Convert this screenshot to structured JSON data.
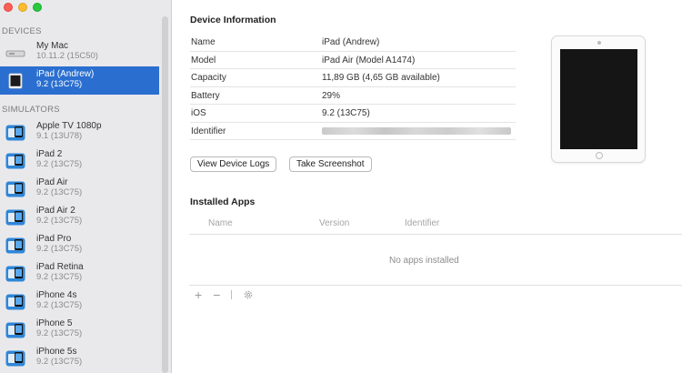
{
  "sidebar": {
    "devices_header": "DEVICES",
    "simulators_header": "SIMULATORS",
    "devices": [
      {
        "name": "My Mac",
        "sub": "10.11.2 (15C50)",
        "icon": "mac-mini-icon"
      },
      {
        "name": "iPad (Andrew)",
        "sub": "9.2 (13C75)",
        "icon": "ipad-icon",
        "selected": true
      }
    ],
    "simulators": [
      {
        "name": "Apple TV 1080p",
        "sub": "9.1 (13U78)"
      },
      {
        "name": "iPad 2",
        "sub": "9.2 (13C75)"
      },
      {
        "name": "iPad Air",
        "sub": "9.2 (13C75)"
      },
      {
        "name": "iPad Air 2",
        "sub": "9.2 (13C75)"
      },
      {
        "name": "iPad Pro",
        "sub": "9.2 (13C75)"
      },
      {
        "name": "iPad Retina",
        "sub": "9.2 (13C75)"
      },
      {
        "name": "iPhone 4s",
        "sub": "9.2 (13C75)"
      },
      {
        "name": "iPhone 5",
        "sub": "9.2 (13C75)"
      },
      {
        "name": "iPhone 5s",
        "sub": "9.2 (13C75)"
      }
    ]
  },
  "device_info": {
    "title": "Device Information",
    "rows": [
      {
        "key": "Name",
        "value": "iPad (Andrew)"
      },
      {
        "key": "Model",
        "value": "iPad Air (Model A1474)"
      },
      {
        "key": "Capacity",
        "value": "11,89 GB (4,65 GB available)"
      },
      {
        "key": "Battery",
        "value": "29%"
      },
      {
        "key": "iOS",
        "value": "9.2 (13C75)"
      },
      {
        "key": "Identifier",
        "value": ""
      }
    ],
    "view_logs_label": "View Device Logs",
    "screenshot_label": "Take Screenshot"
  },
  "installed_apps": {
    "title": "Installed Apps",
    "columns": [
      "Name",
      "Version",
      "Identifier"
    ],
    "empty_text": "No apps installed",
    "add_symbol": "+",
    "remove_symbol": "−",
    "settings_icon": "gear-icon"
  },
  "colors": {
    "selection": "#2a6fd0",
    "sidebar_bg": "#e9e9ec",
    "simulator_icon": "#2f86d8"
  }
}
